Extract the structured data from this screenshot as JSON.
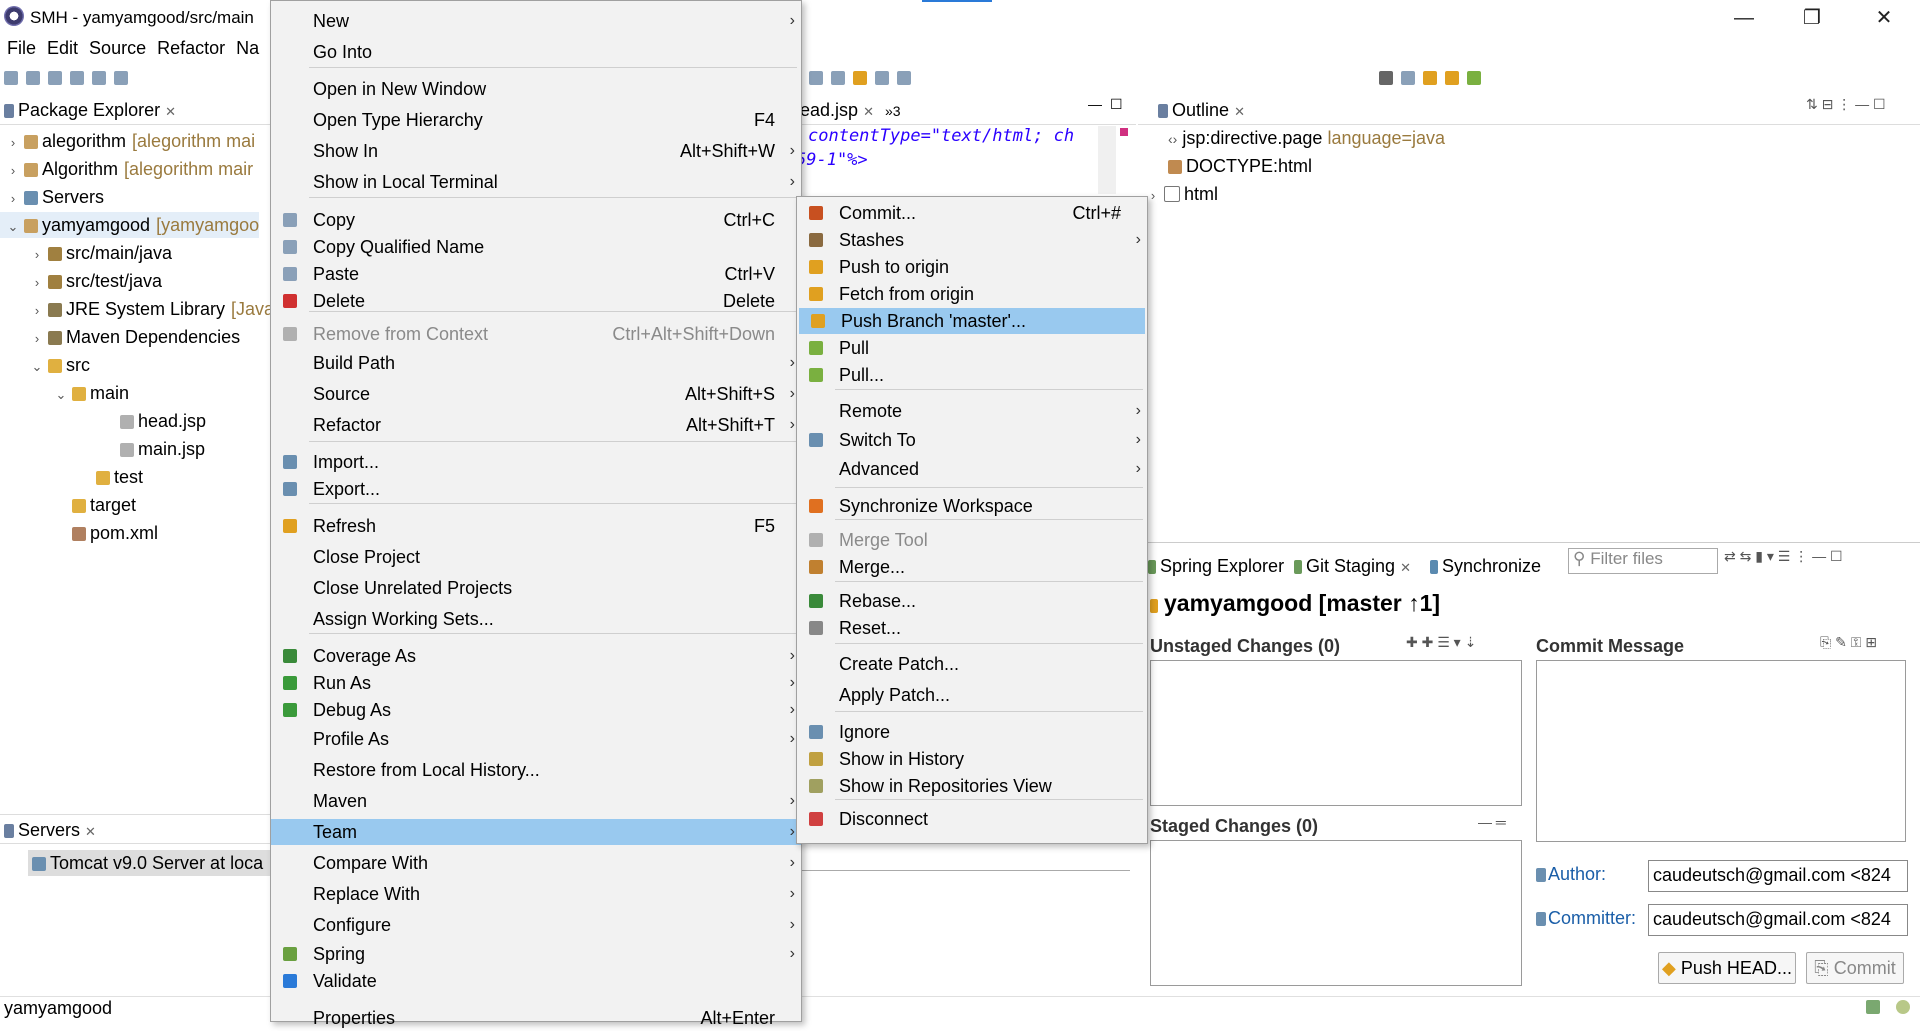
{
  "window": {
    "title": "SMH - yamyamgood/src/main",
    "minimize": "—",
    "maximize": "❐",
    "close": "✕"
  },
  "menubar": [
    "File",
    "Edit",
    "Source",
    "Refactor",
    "Na"
  ],
  "package_explorer": {
    "tab": "Package Explorer",
    "rows": [
      {
        "label": "alegorithm",
        "decor": "[alegorithm mai",
        "indent": 0,
        "twisty": "›"
      },
      {
        "label": "Algorithm",
        "decor": "[alegorithm mair",
        "indent": 0,
        "twisty": "›"
      },
      {
        "label": "Servers",
        "decor": "",
        "indent": 0,
        "twisty": "›"
      },
      {
        "label": "yamyamgood",
        "decor": "[yamyamgoo",
        "indent": 0,
        "twisty": "⌄"
      },
      {
        "label": "src/main/java",
        "decor": "",
        "indent": 1,
        "twisty": "›"
      },
      {
        "label": "src/test/java",
        "decor": "",
        "indent": 1,
        "twisty": "›"
      },
      {
        "label": "JRE System Library",
        "decor": "[Java",
        "indent": 1,
        "twisty": "›"
      },
      {
        "label": "Maven Dependencies",
        "decor": "",
        "indent": 1,
        "twisty": "›"
      },
      {
        "label": "src",
        "decor": "",
        "indent": 1,
        "twisty": "⌄"
      },
      {
        "label": "main",
        "decor": "",
        "indent": 2,
        "twisty": "⌄"
      },
      {
        "label": "head.jsp",
        "decor": "",
        "indent": 4,
        "twisty": ""
      },
      {
        "label": "main.jsp",
        "decor": "",
        "indent": 4,
        "twisty": ""
      },
      {
        "label": "test",
        "decor": "",
        "indent": 3,
        "twisty": ""
      },
      {
        "label": "target",
        "decor": "",
        "indent": 2,
        "twisty": ""
      },
      {
        "label": "pom.xml",
        "decor": "",
        "indent": 2,
        "twisty": ""
      }
    ]
  },
  "servers_view": {
    "tab": "Servers",
    "row": "Tomcat v9.0 Server at loca"
  },
  "status_bar": {
    "text": "yamyamgood"
  },
  "editor": {
    "tab": "ead.jsp",
    "overflow": "»3",
    "line1": "contentType=\"text/html; ch",
    "line2": "59-1\"%>"
  },
  "outline": {
    "title": "Outline",
    "items": [
      {
        "label": "jsp:directive.page",
        "decor": "language=java"
      },
      {
        "label": "DOCTYPE:html",
        "decor": ""
      },
      {
        "label": "html",
        "decor": ""
      }
    ]
  },
  "git_staging": {
    "tabs": [
      "Spring Explorer",
      "Git Staging",
      "Synchronize"
    ],
    "filter_placeholder": "Filter files",
    "repo_title": "yamyamgood [master ↑1]",
    "unstaged": "Unstaged Changes (0)",
    "staged": "Staged Changes (0)",
    "commit_message": "Commit Message",
    "author_label": "Author:",
    "author_value": "caudeutsch@gmail.com <824",
    "committer_label": "Committer:",
    "committer_value": "caudeutsch@gmail.com <824",
    "push_button": "Push HEAD...",
    "commit_button": "Commit"
  },
  "context_menu": {
    "items": [
      {
        "label": "New",
        "arrow": true
      },
      {
        "label": "Go Into"
      },
      {
        "label": "Open in New Window"
      },
      {
        "label": "Open Type Hierarchy",
        "shortcut": "F4"
      },
      {
        "label": "Show In",
        "shortcut": "Alt+Shift+W",
        "arrow": true
      },
      {
        "label": "Show in Local Terminal",
        "arrow": true
      },
      {
        "label": "Copy",
        "shortcut": "Ctrl+C"
      },
      {
        "label": "Copy Qualified Name"
      },
      {
        "label": "Paste",
        "shortcut": "Ctrl+V"
      },
      {
        "label": "Delete",
        "shortcut": "Delete"
      },
      {
        "label": "Remove from Context",
        "shortcut": "Ctrl+Alt+Shift+Down",
        "disabled": true
      },
      {
        "label": "Build Path",
        "arrow": true
      },
      {
        "label": "Source",
        "shortcut": "Alt+Shift+S",
        "arrow": true
      },
      {
        "label": "Refactor",
        "shortcut": "Alt+Shift+T",
        "arrow": true
      },
      {
        "label": "Import..."
      },
      {
        "label": "Export..."
      },
      {
        "label": "Refresh",
        "shortcut": "F5"
      },
      {
        "label": "Close Project"
      },
      {
        "label": "Close Unrelated Projects"
      },
      {
        "label": "Assign Working Sets..."
      },
      {
        "label": "Coverage As",
        "arrow": true
      },
      {
        "label": "Run As",
        "arrow": true
      },
      {
        "label": "Debug As",
        "arrow": true
      },
      {
        "label": "Profile As",
        "arrow": true
      },
      {
        "label": "Restore from Local History..."
      },
      {
        "label": "Maven",
        "arrow": true
      },
      {
        "label": "Team",
        "arrow": true,
        "selected": true
      },
      {
        "label": "Compare With",
        "arrow": true
      },
      {
        "label": "Replace With",
        "arrow": true
      },
      {
        "label": "Configure",
        "arrow": true
      },
      {
        "label": "Spring",
        "arrow": true
      },
      {
        "label": "Validate"
      },
      {
        "label": "Properties",
        "shortcut": "Alt+Enter"
      }
    ]
  },
  "team_submenu": {
    "items": [
      {
        "label": "Commit...",
        "shortcut": "Ctrl+#"
      },
      {
        "label": "Stashes",
        "arrow": true
      },
      {
        "label": "Push to origin"
      },
      {
        "label": "Fetch from origin"
      },
      {
        "label": "Push Branch 'master'...",
        "selected": true
      },
      {
        "label": "Pull"
      },
      {
        "label": "Pull..."
      },
      {
        "label": "Remote",
        "arrow": true
      },
      {
        "label": "Switch To",
        "arrow": true
      },
      {
        "label": "Advanced",
        "arrow": true
      },
      {
        "label": "Synchronize Workspace"
      },
      {
        "label": "Merge Tool",
        "disabled": true
      },
      {
        "label": "Merge..."
      },
      {
        "label": "Rebase..."
      },
      {
        "label": "Reset..."
      },
      {
        "label": "Create Patch..."
      },
      {
        "label": "Apply Patch..."
      },
      {
        "label": "Ignore"
      },
      {
        "label": "Show in History"
      },
      {
        "label": "Show in Repositories View"
      },
      {
        "label": "Disconnect"
      }
    ]
  },
  "colors": {
    "selection": "#99c9ef",
    "menu_bg": "#f2f2f2",
    "decoration": "#9a7a3e",
    "code_string": "#2a00ff"
  }
}
